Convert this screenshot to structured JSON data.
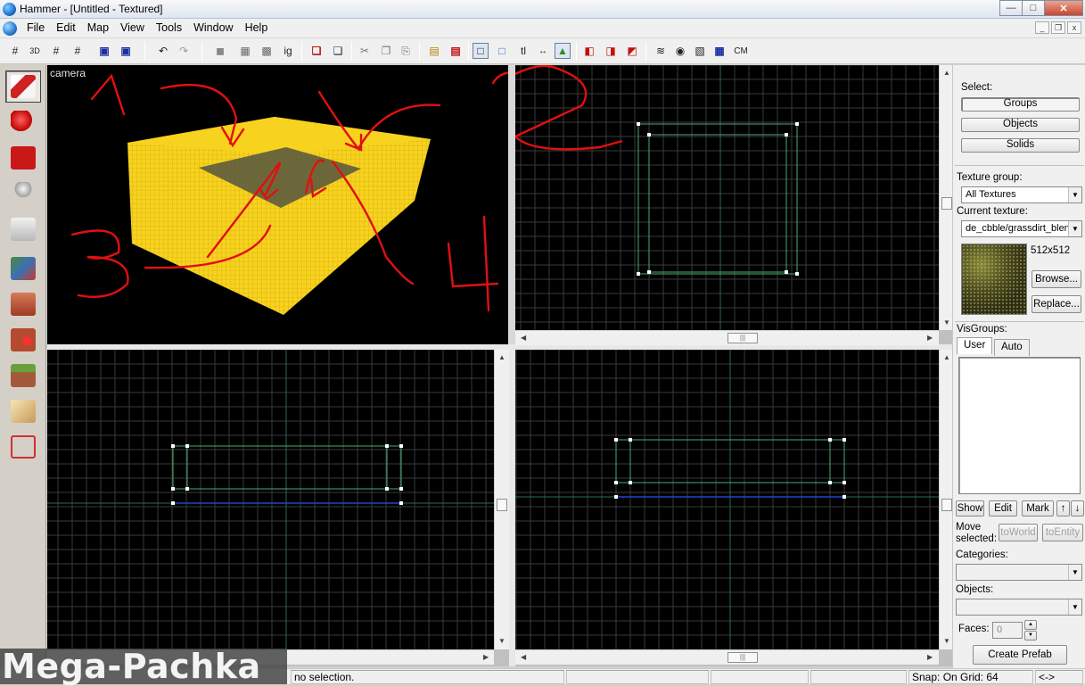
{
  "window": {
    "title": "Hammer - [Untitled - Textured]",
    "minimize": "—",
    "maximize": "□",
    "close": "✕"
  },
  "menubar": {
    "items": [
      "File",
      "Edit",
      "Map",
      "View",
      "Tools",
      "Window",
      "Help"
    ],
    "mdi": [
      "_",
      "❐",
      "x"
    ]
  },
  "toolbar": {
    "undo": "↶",
    "redo": "↷",
    "ig": "ig",
    "tl": "tl",
    "cm": "CM"
  },
  "viewports": {
    "camera_label": "camera"
  },
  "annotations": [
    "1",
    "2",
    "3",
    "4"
  ],
  "right_panel": {
    "select_label": "Select:",
    "select_buttons": [
      "Groups",
      "Objects",
      "Solids"
    ],
    "texture_group_label": "Texture group:",
    "texture_group_value": "All Textures",
    "current_texture_label": "Current texture:",
    "current_texture_value": "de_cbble/grassdirt_blen",
    "texture_size": "512x512",
    "browse": "Browse...",
    "replace": "Replace...",
    "visgroups_label": "VisGroups:",
    "tabs": [
      "User",
      "Auto"
    ],
    "vis_buttons": [
      "Show",
      "Edit",
      "Mark"
    ],
    "move_selected_label_1": "Move",
    "move_selected_label_2": "selected:",
    "to_world": "toWorld",
    "to_entity": "toEntity",
    "categories_label": "Categories:",
    "objects_label": "Objects:",
    "faces_label": "Faces:",
    "faces_value": "0",
    "create_prefab": "Create Prefab"
  },
  "statusbar": {
    "message": "no selection.",
    "snap": "Snap: On Grid: 64",
    "extra": "<->"
  },
  "watermark": "Mega-Pachka",
  "colors": {
    "brush_yellow": "#f7d21e",
    "annotation_red": "#e01010",
    "grid_line": "#3a3a3a",
    "brush_outline": "#4caa74",
    "axis_blue": "#2244cc"
  }
}
